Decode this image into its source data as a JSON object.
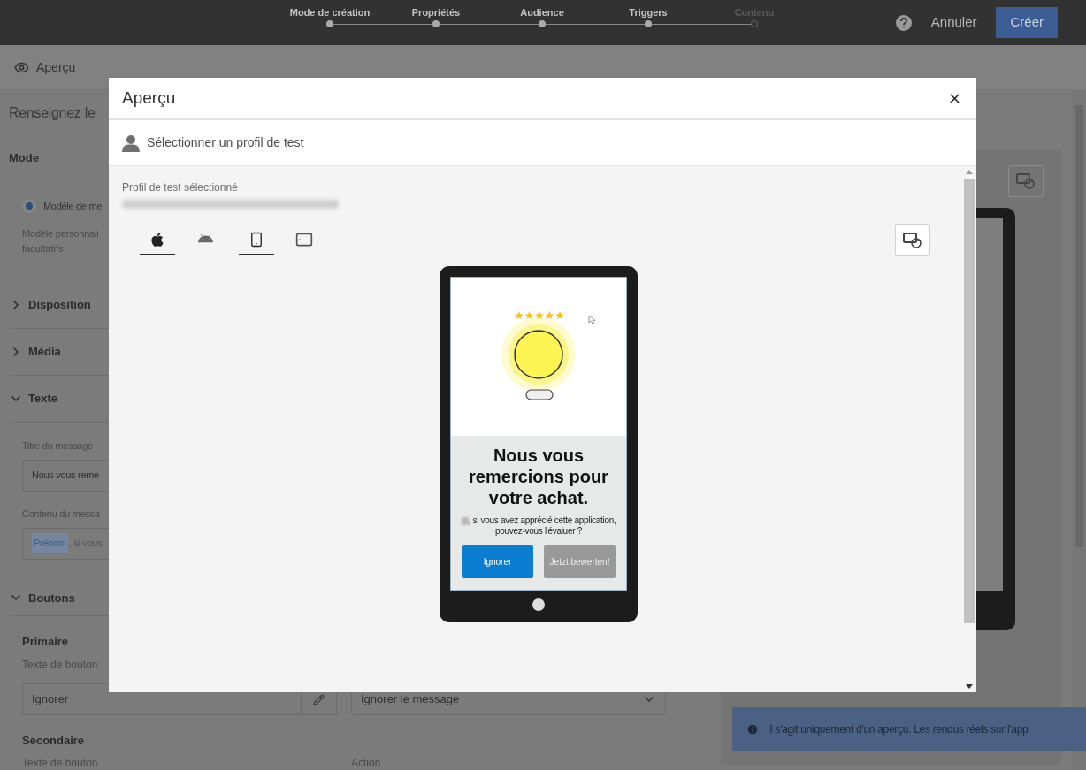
{
  "top_bar": {
    "steps": [
      {
        "label": "Mode de création",
        "done": true
      },
      {
        "label": "Propriétés",
        "done": true
      },
      {
        "label": "Audience",
        "done": true
      },
      {
        "label": "Triggers",
        "done": true
      },
      {
        "label": "Contenu",
        "done": false
      }
    ],
    "cancel": "Annuler",
    "create": "Créer"
  },
  "subheader": {
    "title": "Aperçu"
  },
  "form": {
    "title": "Renseignez le",
    "mode": {
      "heading": "Mode",
      "option": "Modèle de me",
      "option_selected": true,
      "description": "Modèle personnali",
      "description_2": "facultatifs."
    },
    "sections": [
      {
        "label": "Disposition",
        "expanded": false
      },
      {
        "label": "Média",
        "expanded": false
      },
      {
        "label": "Texte",
        "expanded": true
      }
    ],
    "text_fields": [
      {
        "label": "Titre du message",
        "value": "Nous vous reme"
      },
      {
        "label": "Contenu du messa",
        "token": "Prénom",
        "value": ", si vous"
      }
    ],
    "buttons_section": {
      "label": "Boutons",
      "expanded": true,
      "primary": {
        "heading": "Primaire",
        "label": "Texte de bouton",
        "value": "Ignorer",
        "action_value": "Ignorer le message"
      },
      "secondary": {
        "heading": "Secondaire",
        "label": "Texte de bouton",
        "action_label": "Action"
      }
    }
  },
  "preview_panel": {
    "notice": "Il s'agit uniquement d'un aperçu. Les rendus réels sur l'app"
  },
  "modal": {
    "title": "Aperçu",
    "profile_picker": "Sélectionner un profil de test",
    "profile_label": "Profil de test sélectionné",
    "platforms": [
      {
        "kind": "apple",
        "selected": true
      },
      {
        "kind": "android",
        "selected": false
      }
    ],
    "devices": [
      {
        "kind": "phone",
        "selected": true
      },
      {
        "kind": "tablet",
        "selected": false
      }
    ],
    "message": {
      "title": "Nous vous remercions pour votre achat.",
      "body": ", si vous avez apprécié cette application, pouvez-vous l'évaluer ?",
      "buttons": [
        {
          "label": "Ignorer",
          "kind": "primary"
        },
        {
          "label": "Jetzt bewerten!",
          "kind": "secondary"
        }
      ]
    }
  }
}
